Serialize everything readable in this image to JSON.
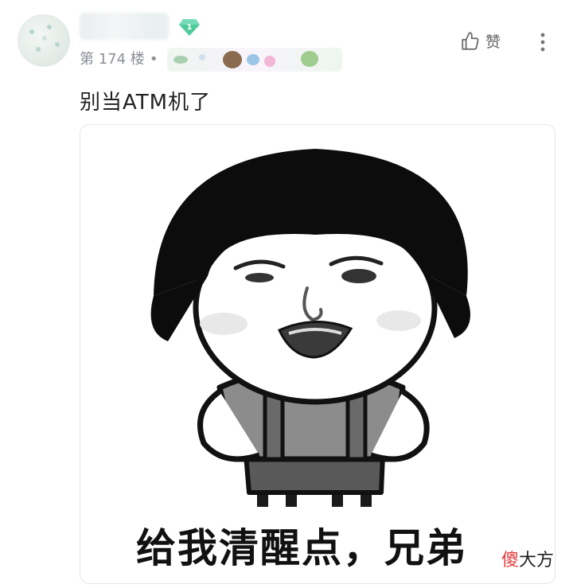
{
  "post": {
    "floor_label": "第 174 楼",
    "separator": "•",
    "level": "1",
    "like_label": "赞",
    "comment_text": "别当ATM机了"
  },
  "meme": {
    "caption": "给我清醒点，兄弟"
  },
  "watermark": {
    "char1": "傻",
    "char2": "大方"
  },
  "colors": {
    "level_badge": "#4ecb9b",
    "hair": "#0c0c0c",
    "shirt": "#8c8c8c",
    "shorts": "#595959",
    "watermark_accent": "#e43b3b"
  },
  "icons": [
    "thumbs-up-icon",
    "more-vertical-icon",
    "level-gem-icon"
  ]
}
